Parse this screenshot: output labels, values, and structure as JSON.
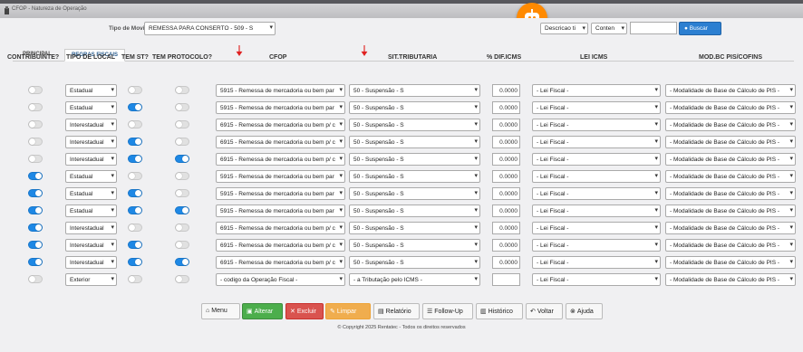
{
  "window": {
    "title": "CFOP - Natureza de Operação"
  },
  "filter": {
    "label": "Tipo de Movimento",
    "value": "REMESSA PARA CONSERTO - 509 - S",
    "search_field": "Descricao ti",
    "search_mode": "Conten",
    "search_value": "",
    "search_button": "Buscar"
  },
  "tabs": [
    {
      "label": "PRINCIPAL"
    },
    {
      "label": "REGRAS FISCAIS"
    }
  ],
  "columns": {
    "contribuinte": "CONTRIBUINTE?",
    "tipo_local": "TIPO DE LOCAL",
    "tem_st": "TEM ST?",
    "tem_protocolo": "TEM PROTOCOLO?",
    "cfop": "CFOP",
    "sit_tributaria": "SIT.TRIBUTARIA",
    "dif_icms": "% DIF.ICMS",
    "lei_icms": "LEI ICMS",
    "mod_bc": "MOD.BC PIS/COFINS"
  },
  "rows": [
    {
      "contribuinte": false,
      "tipo_local": "Estadual",
      "tem_st": false,
      "tem_protocolo": false,
      "cfop": "5915 - Remessa de mercadoria ou bem par",
      "sit": "50 - Suspensão - S",
      "dif": "0.0000",
      "lei": "- Lei Fiscal -",
      "mod": "- Modalidade de Base de Cálculo de PIS -"
    },
    {
      "contribuinte": false,
      "tipo_local": "Estadual",
      "tem_st": true,
      "tem_protocolo": false,
      "cfop": "5915 - Remessa de mercadoria ou bem par",
      "sit": "50 - Suspensão - S",
      "dif": "0.0000",
      "lei": "- Lei Fiscal -",
      "mod": "- Modalidade de Base de Cálculo de PIS -"
    },
    {
      "contribuinte": false,
      "tipo_local": "Interestadual",
      "tem_st": false,
      "tem_protocolo": false,
      "cfop": "6915 - Remessa de mercadoria ou bem p/ c",
      "sit": "50 - Suspensão - S",
      "dif": "0.0000",
      "lei": "- Lei Fiscal -",
      "mod": "- Modalidade de Base de Cálculo de PIS -"
    },
    {
      "contribuinte": false,
      "tipo_local": "Interestadual",
      "tem_st": true,
      "tem_protocolo": false,
      "cfop": "6915 - Remessa de mercadoria ou bem p/ c",
      "sit": "50 - Suspensão - S",
      "dif": "0.0000",
      "lei": "- Lei Fiscal -",
      "mod": "- Modalidade de Base de Cálculo de PIS -"
    },
    {
      "contribuinte": false,
      "tipo_local": "Interestadual",
      "tem_st": true,
      "tem_protocolo": true,
      "cfop": "6915 - Remessa de mercadoria ou bem p/ c",
      "sit": "50 - Suspensão - S",
      "dif": "0.0000",
      "lei": "- Lei Fiscal -",
      "mod": "- Modalidade de Base de Cálculo de PIS -"
    },
    {
      "contribuinte": true,
      "tipo_local": "Estadual",
      "tem_st": false,
      "tem_protocolo": false,
      "cfop": "5915 - Remessa de mercadoria ou bem par",
      "sit": "50 - Suspensão - S",
      "dif": "0.0000",
      "lei": "- Lei Fiscal -",
      "mod": "- Modalidade de Base de Cálculo de PIS -"
    },
    {
      "contribuinte": true,
      "tipo_local": "Estadual",
      "tem_st": true,
      "tem_protocolo": false,
      "cfop": "5915 - Remessa de mercadoria ou bem par",
      "sit": "50 - Suspensão - S",
      "dif": "0.0000",
      "lei": "- Lei Fiscal -",
      "mod": "- Modalidade de Base de Cálculo de PIS -"
    },
    {
      "contribuinte": true,
      "tipo_local": "Estadual",
      "tem_st": true,
      "tem_protocolo": true,
      "cfop": "5915 - Remessa de mercadoria ou bem par",
      "sit": "50 - Suspensão - S",
      "dif": "0.0000",
      "lei": "- Lei Fiscal -",
      "mod": "- Modalidade de Base de Cálculo de PIS -"
    },
    {
      "contribuinte": true,
      "tipo_local": "Interestadual",
      "tem_st": false,
      "tem_protocolo": false,
      "cfop": "6915 - Remessa de mercadoria ou bem p/ c",
      "sit": "50 - Suspensão - S",
      "dif": "0.0000",
      "lei": "- Lei Fiscal -",
      "mod": "- Modalidade de Base de Cálculo de PIS -"
    },
    {
      "contribuinte": true,
      "tipo_local": "Interestadual",
      "tem_st": true,
      "tem_protocolo": false,
      "cfop": "6915 - Remessa de mercadoria ou bem p/ c",
      "sit": "50 - Suspensão - S",
      "dif": "0.0000",
      "lei": "- Lei Fiscal -",
      "mod": "- Modalidade de Base de Cálculo de PIS -"
    },
    {
      "contribuinte": true,
      "tipo_local": "Interestadual",
      "tem_st": true,
      "tem_protocolo": true,
      "cfop": "6915 - Remessa de mercadoria ou bem p/ c",
      "sit": "50 - Suspensão - S",
      "dif": "0.0000",
      "lei": "- Lei Fiscal -",
      "mod": "- Modalidade de Base de Cálculo de PIS -"
    },
    {
      "contribuinte": false,
      "tipo_local": "Exterior",
      "tem_st": false,
      "tem_protocolo": false,
      "cfop": "- codigo da Operação Fiscal -",
      "sit": "- a Tributação pelo ICMS -",
      "dif": "",
      "lei": "- Lei Fiscal -",
      "mod": "- Modalidade de Base de Cálculo de PIS -"
    }
  ],
  "buttons": [
    {
      "key": "menu",
      "label": "Menu",
      "icon": "home-icon",
      "glyph": "⌂"
    },
    {
      "key": "alterar",
      "label": "Alterar",
      "icon": "save-icon",
      "glyph": "▣"
    },
    {
      "key": "excluir",
      "label": "Excluir",
      "icon": "close-icon",
      "glyph": "✕"
    },
    {
      "key": "limpar",
      "label": "Limpar",
      "icon": "eraser-icon",
      "glyph": "✎"
    },
    {
      "key": "relatorio",
      "label": "Relatório",
      "icon": "report-icon",
      "glyph": "▤"
    },
    {
      "key": "followup",
      "label": "Follow-Up",
      "icon": "list-icon",
      "glyph": "☰"
    },
    {
      "key": "historico",
      "label": "Histórico",
      "icon": "history-icon",
      "glyph": "▥"
    },
    {
      "key": "voltar",
      "label": "Voltar",
      "icon": "back-icon",
      "glyph": "↶"
    },
    {
      "key": "ajuda",
      "label": "Ajuda",
      "icon": "help-icon",
      "glyph": "⊗"
    }
  ],
  "copyright": "© Copyright 2025 Rentatec - Todos os direitos reservados",
  "colors": {
    "toggle_on": "#1e88e5",
    "accent_orange": "#ff8a00",
    "buscar": "#2c7fd1",
    "arrow": "#e02020"
  }
}
